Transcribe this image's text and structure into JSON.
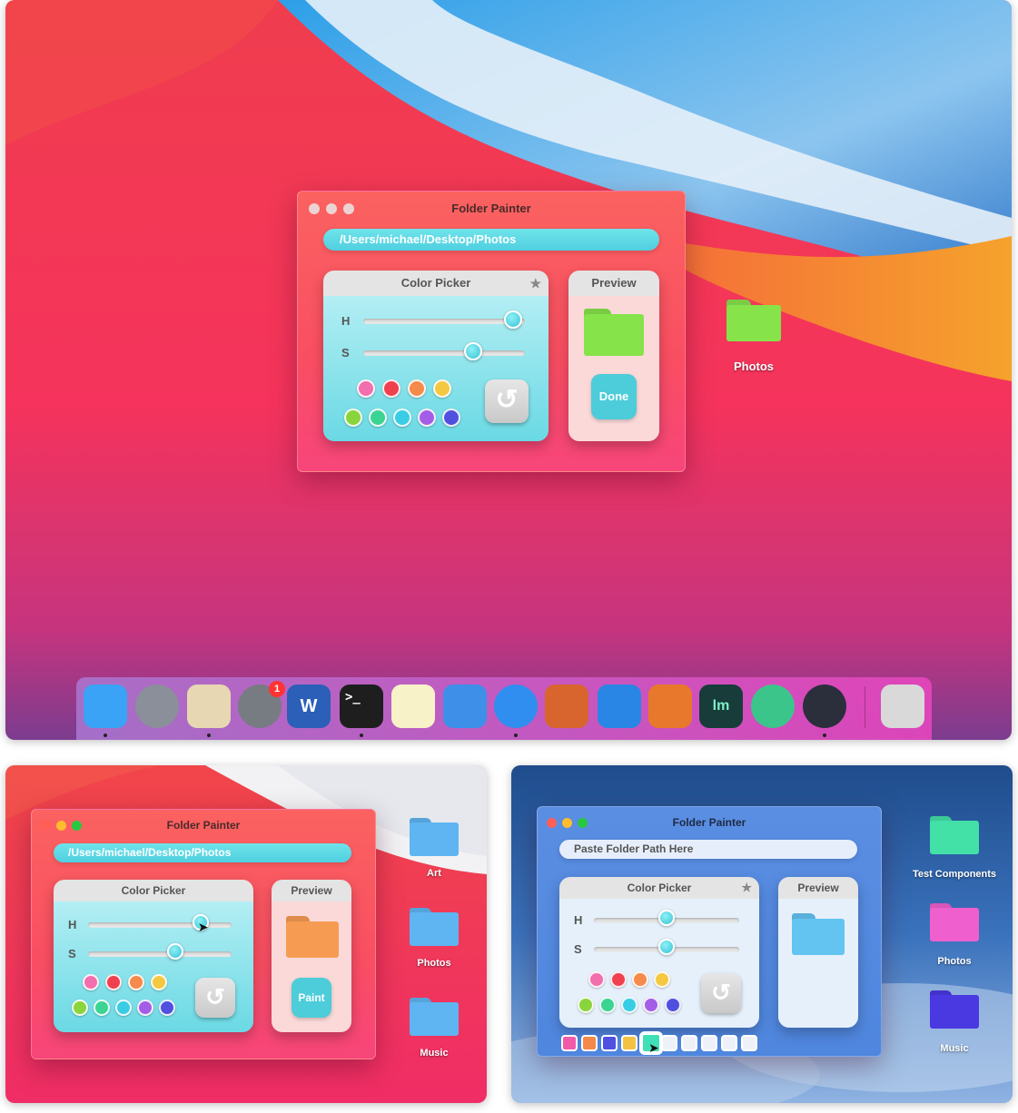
{
  "main": {
    "window_title": "Folder Painter",
    "path": "/Users/michael/Desktop/Photos",
    "color_picker_title": "Color Picker",
    "preview_title": "Preview",
    "slider_h_label": "H",
    "slider_s_label": "S",
    "slider_h_value": 0.98,
    "slider_s_value": 0.7,
    "done_label": "Done",
    "desktop_folder_label": "Photos",
    "preview_folder_color": "#86e34a",
    "swatches_top": [
      "#f26eac",
      "#f0404f",
      "#f58a4a",
      "#f5c842"
    ],
    "swatches_bottom": [
      "#8ad43c",
      "#3cd493",
      "#38cde4",
      "#a45ee6",
      "#5050e0"
    ],
    "star_icon": "star-icon",
    "reset_icon": "reset-icon"
  },
  "dock": {
    "notification_badge": "1",
    "apps": [
      {
        "name": "finder-icon",
        "color": "#3aa3f5"
      },
      {
        "name": "launchpad-icon",
        "color": "#8a8f9a"
      },
      {
        "name": "mail-icon",
        "color": "#e7d7b2"
      },
      {
        "name": "system-preferences-icon",
        "color": "#777b82"
      },
      {
        "name": "word-icon",
        "color": "#2b5fb8"
      },
      {
        "name": "terminal-icon",
        "color": "#1e1e1e"
      },
      {
        "name": "notes-icon",
        "color": "#f8f2c8"
      },
      {
        "name": "textedit-icon",
        "color": "#3d8fe8"
      },
      {
        "name": "safari-icon",
        "color": "#2f8ef0"
      },
      {
        "name": "matlab-icon",
        "color": "#d8642e"
      },
      {
        "name": "xcode-icon",
        "color": "#2a86e4"
      },
      {
        "name": "blender-icon",
        "color": "#e8782c"
      },
      {
        "name": "lm-studio-icon",
        "color": "#173c3a"
      },
      {
        "name": "atom-green-icon",
        "color": "#3bc58b"
      },
      {
        "name": "electron-icon",
        "color": "#2b2e3b"
      },
      {
        "name": "trash-icon",
        "color": "#d9d9d9"
      }
    ],
    "word_letter": "W",
    "terminal_prompt": ">_",
    "lm_letters": "lm"
  },
  "left": {
    "window_title": "Folder Painter",
    "path": "/Users/michael/Desktop/Photos",
    "color_picker_title": "Color Picker",
    "preview_title": "Preview",
    "slider_h_label": "H",
    "slider_s_label": "S",
    "slider_h_value": 0.82,
    "slider_s_value": 0.62,
    "paint_label": "Paint",
    "preview_folder_color": "#f69c52",
    "folders": [
      "Art",
      "Photos",
      "Music"
    ],
    "folder_color": "#5fb5f2"
  },
  "right": {
    "window_title": "Folder Painter",
    "path_placeholder": "Paste Folder Path Here",
    "color_picker_title": "Color Picker",
    "preview_title": "Preview",
    "slider_h_label": "H",
    "slider_s_label": "S",
    "slider_h_value": 0.5,
    "slider_s_value": 0.5,
    "preview_folder_color": "#63c4f2",
    "folders": [
      {
        "label": "Test Components",
        "color": "#43e0a8"
      },
      {
        "label": "Photos",
        "color": "#ef5fce"
      },
      {
        "label": "Music",
        "color": "#4a38e0"
      }
    ],
    "history_colors": [
      "#f15aa8",
      "#f58a48",
      "#5050e0",
      "#f3c242",
      "#3fe0b8"
    ]
  }
}
